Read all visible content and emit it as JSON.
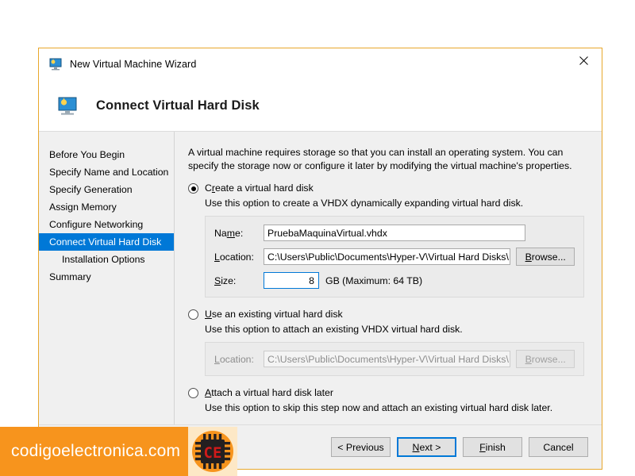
{
  "window": {
    "title": "New Virtual Machine Wizard",
    "close_label": "×",
    "icon": "virtual-machine-monitor-icon",
    "border_color": "#e8a72c"
  },
  "header": {
    "title": "Connect Virtual Hard Disk",
    "icon": "virtual-machine-monitor-icon"
  },
  "sidebar": {
    "items": [
      {
        "label": "Before You Begin",
        "selected": false,
        "sub": false
      },
      {
        "label": "Specify Name and Location",
        "selected": false,
        "sub": false
      },
      {
        "label": "Specify Generation",
        "selected": false,
        "sub": false
      },
      {
        "label": "Assign Memory",
        "selected": false,
        "sub": false
      },
      {
        "label": "Configure Networking",
        "selected": false,
        "sub": false
      },
      {
        "label": "Connect Virtual Hard Disk",
        "selected": true,
        "sub": false
      },
      {
        "label": "Installation Options",
        "selected": false,
        "sub": true
      },
      {
        "label": "Summary",
        "selected": false,
        "sub": false
      }
    ],
    "selected_bg": "#0078d7"
  },
  "content": {
    "intro": "A virtual machine requires storage so that you can install an operating system. You can specify the storage now or configure it later by modifying the virtual machine's properties.",
    "options": [
      {
        "label_pre": "C",
        "label_accel": "r",
        "label_post": "eate a virtual hard disk",
        "label_full": "Create a virtual hard disk",
        "checked": true,
        "hint": "Use this option to create a VHDX dynamically expanding virtual hard disk.",
        "disabled": false
      },
      {
        "label_pre": "",
        "label_accel": "U",
        "label_post": "se an existing virtual hard disk",
        "label_full": "Use an existing virtual hard disk",
        "checked": false,
        "hint": "Use this option to attach an existing VHDX virtual hard disk.",
        "disabled": true
      },
      {
        "label_pre": "",
        "label_accel": "A",
        "label_post": "ttach a virtual hard disk later",
        "label_full": "Attach a virtual hard disk later",
        "checked": false,
        "hint": "Use this option to skip this step now and attach an existing virtual hard disk later.",
        "disabled": false
      }
    ],
    "create_group": {
      "name_label": "Name:",
      "name_value": "PruebaMaquinaVirtual.vhdx",
      "location_label": "Location:",
      "location_value": "C:\\Users\\Public\\Documents\\Hyper-V\\Virtual Hard Disks\\",
      "browse_label": "Browse...",
      "size_label": "Size:",
      "size_value": "8",
      "size_suffix": "GB (Maximum: 64 TB)"
    },
    "existing_group": {
      "location_label": "Location:",
      "location_value": "C:\\Users\\Public\\Documents\\Hyper-V\\Virtual Hard Disks\\",
      "browse_label": "Browse..."
    }
  },
  "footer": {
    "buttons": [
      {
        "label": "< Previous",
        "default": false
      },
      {
        "label": "Next >",
        "default": true
      },
      {
        "label": "Finish",
        "default": false
      },
      {
        "label": "Cancel",
        "default": false
      }
    ],
    "default_border_color": "#0078d7"
  },
  "watermark": {
    "text": "codigoelectronica.com",
    "bar_color": "#f7941d",
    "logo_text": "CE",
    "logo_circle_color": "#f7941d",
    "logo_chip_color": "#231f20",
    "logo_led_color": "#d01a1a"
  }
}
